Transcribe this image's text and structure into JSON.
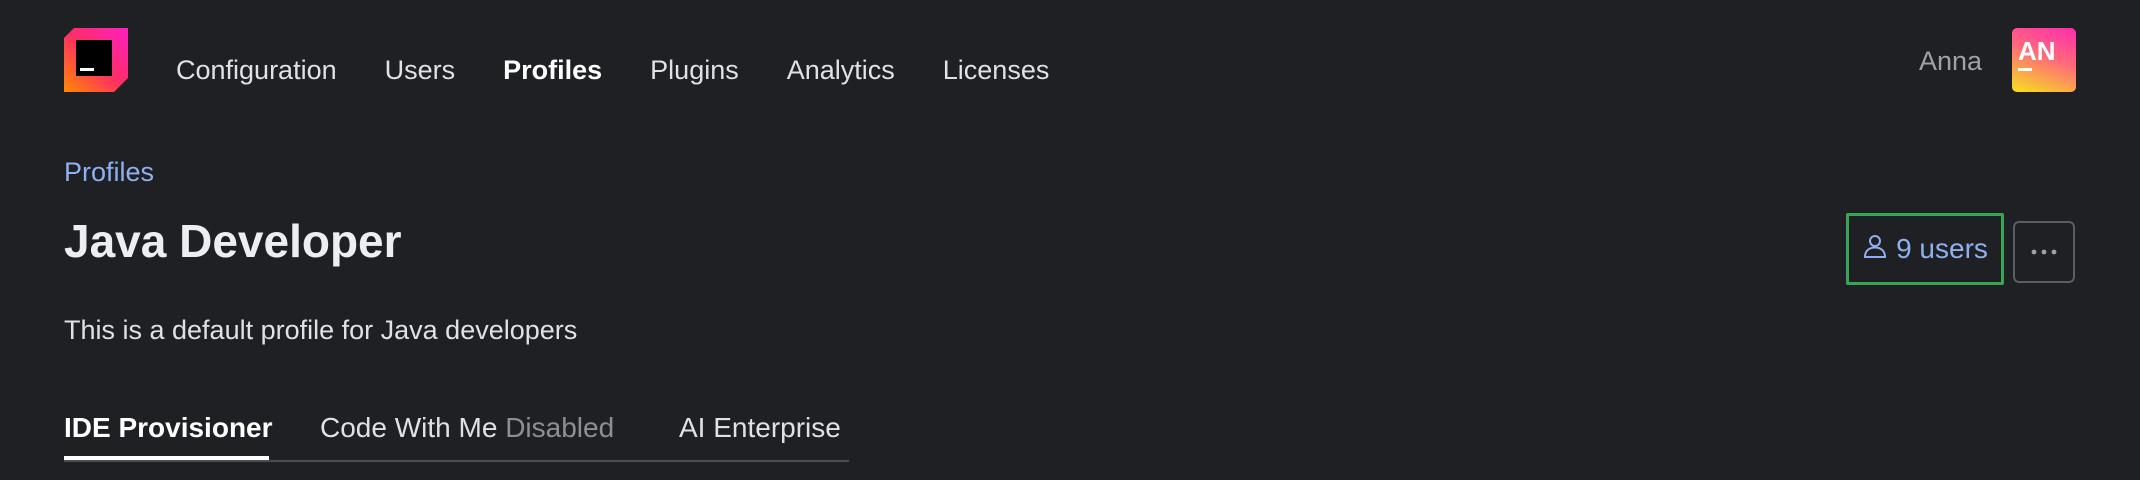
{
  "header": {
    "logo_icon": "jetbrains-logo-icon",
    "nav": [
      {
        "label": "Configuration",
        "active": false
      },
      {
        "label": "Users",
        "active": false
      },
      {
        "label": "Profiles",
        "active": true
      },
      {
        "label": "Plugins",
        "active": false
      },
      {
        "label": "Analytics",
        "active": false
      },
      {
        "label": "Licenses",
        "active": false
      }
    ],
    "user_name": "Anna",
    "avatar_initials": "AN"
  },
  "page": {
    "breadcrumb": "Profiles",
    "title": "Java Developer",
    "description": "This is a default profile for Java developers",
    "users_button_label": "9 users",
    "users_icon": "user-icon",
    "more_icon": "more-horizontal-icon"
  },
  "tabs": [
    {
      "label": "IDE Provisioner",
      "active": true
    },
    {
      "label": "Code With Me",
      "suffix": "Disabled",
      "active": false
    },
    {
      "label": "AI Enterprise",
      "active": false
    }
  ],
  "colors": {
    "background": "#1f2023",
    "link": "#8fb0f0",
    "highlight_border": "#3aa552"
  }
}
